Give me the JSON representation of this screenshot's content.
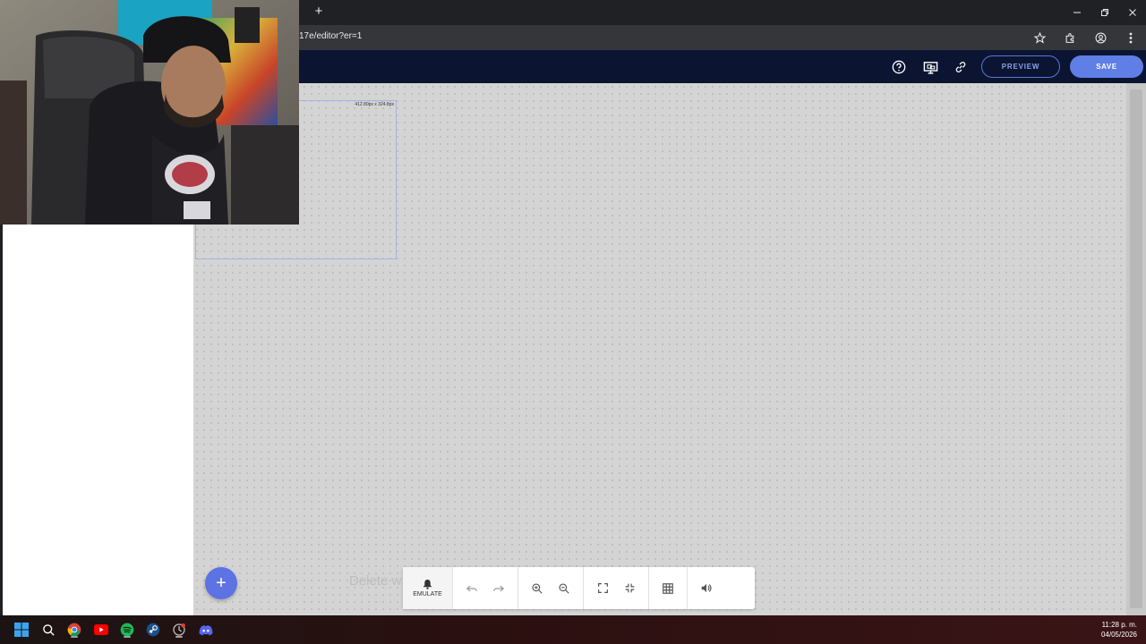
{
  "browser": {
    "url": "17e/editor?er=1",
    "new_tab_label": "+",
    "window_controls": [
      "minimize-icon",
      "restore-icon",
      "close-icon"
    ],
    "address_icons": [
      "bookmark-star-icon",
      "extensions-icon",
      "profile-icon",
      "menu-icon"
    ]
  },
  "header": {
    "icons": [
      "help-icon",
      "screen-share-icon",
      "link-icon"
    ],
    "preview_label": "PREVIEW",
    "save_label": "SAVE",
    "bg_color": "#0b1532",
    "accent_color": "#5f7fe6"
  },
  "canvas": {
    "frame_size": "412.80px x 324.8px",
    "delete_hint": "Delete w",
    "add_button_label": "+"
  },
  "toolbar": {
    "emulate_label": "EMULATE",
    "buttons": [
      "bell-icon",
      "undo-icon",
      "redo-icon",
      "zoom-in-icon",
      "zoom-out-icon",
      "fullscreen-icon",
      "exit-fullscreen-icon",
      "grid-icon",
      "volume-icon"
    ]
  },
  "taskbar": {
    "apps": [
      "windows-start-icon",
      "search-icon",
      "chrome-icon",
      "youtube-icon",
      "spotify-icon",
      "steam-icon",
      "app-icon",
      "discord-icon"
    ],
    "time": "11:28 p. m.",
    "date": "04/05/2026"
  }
}
